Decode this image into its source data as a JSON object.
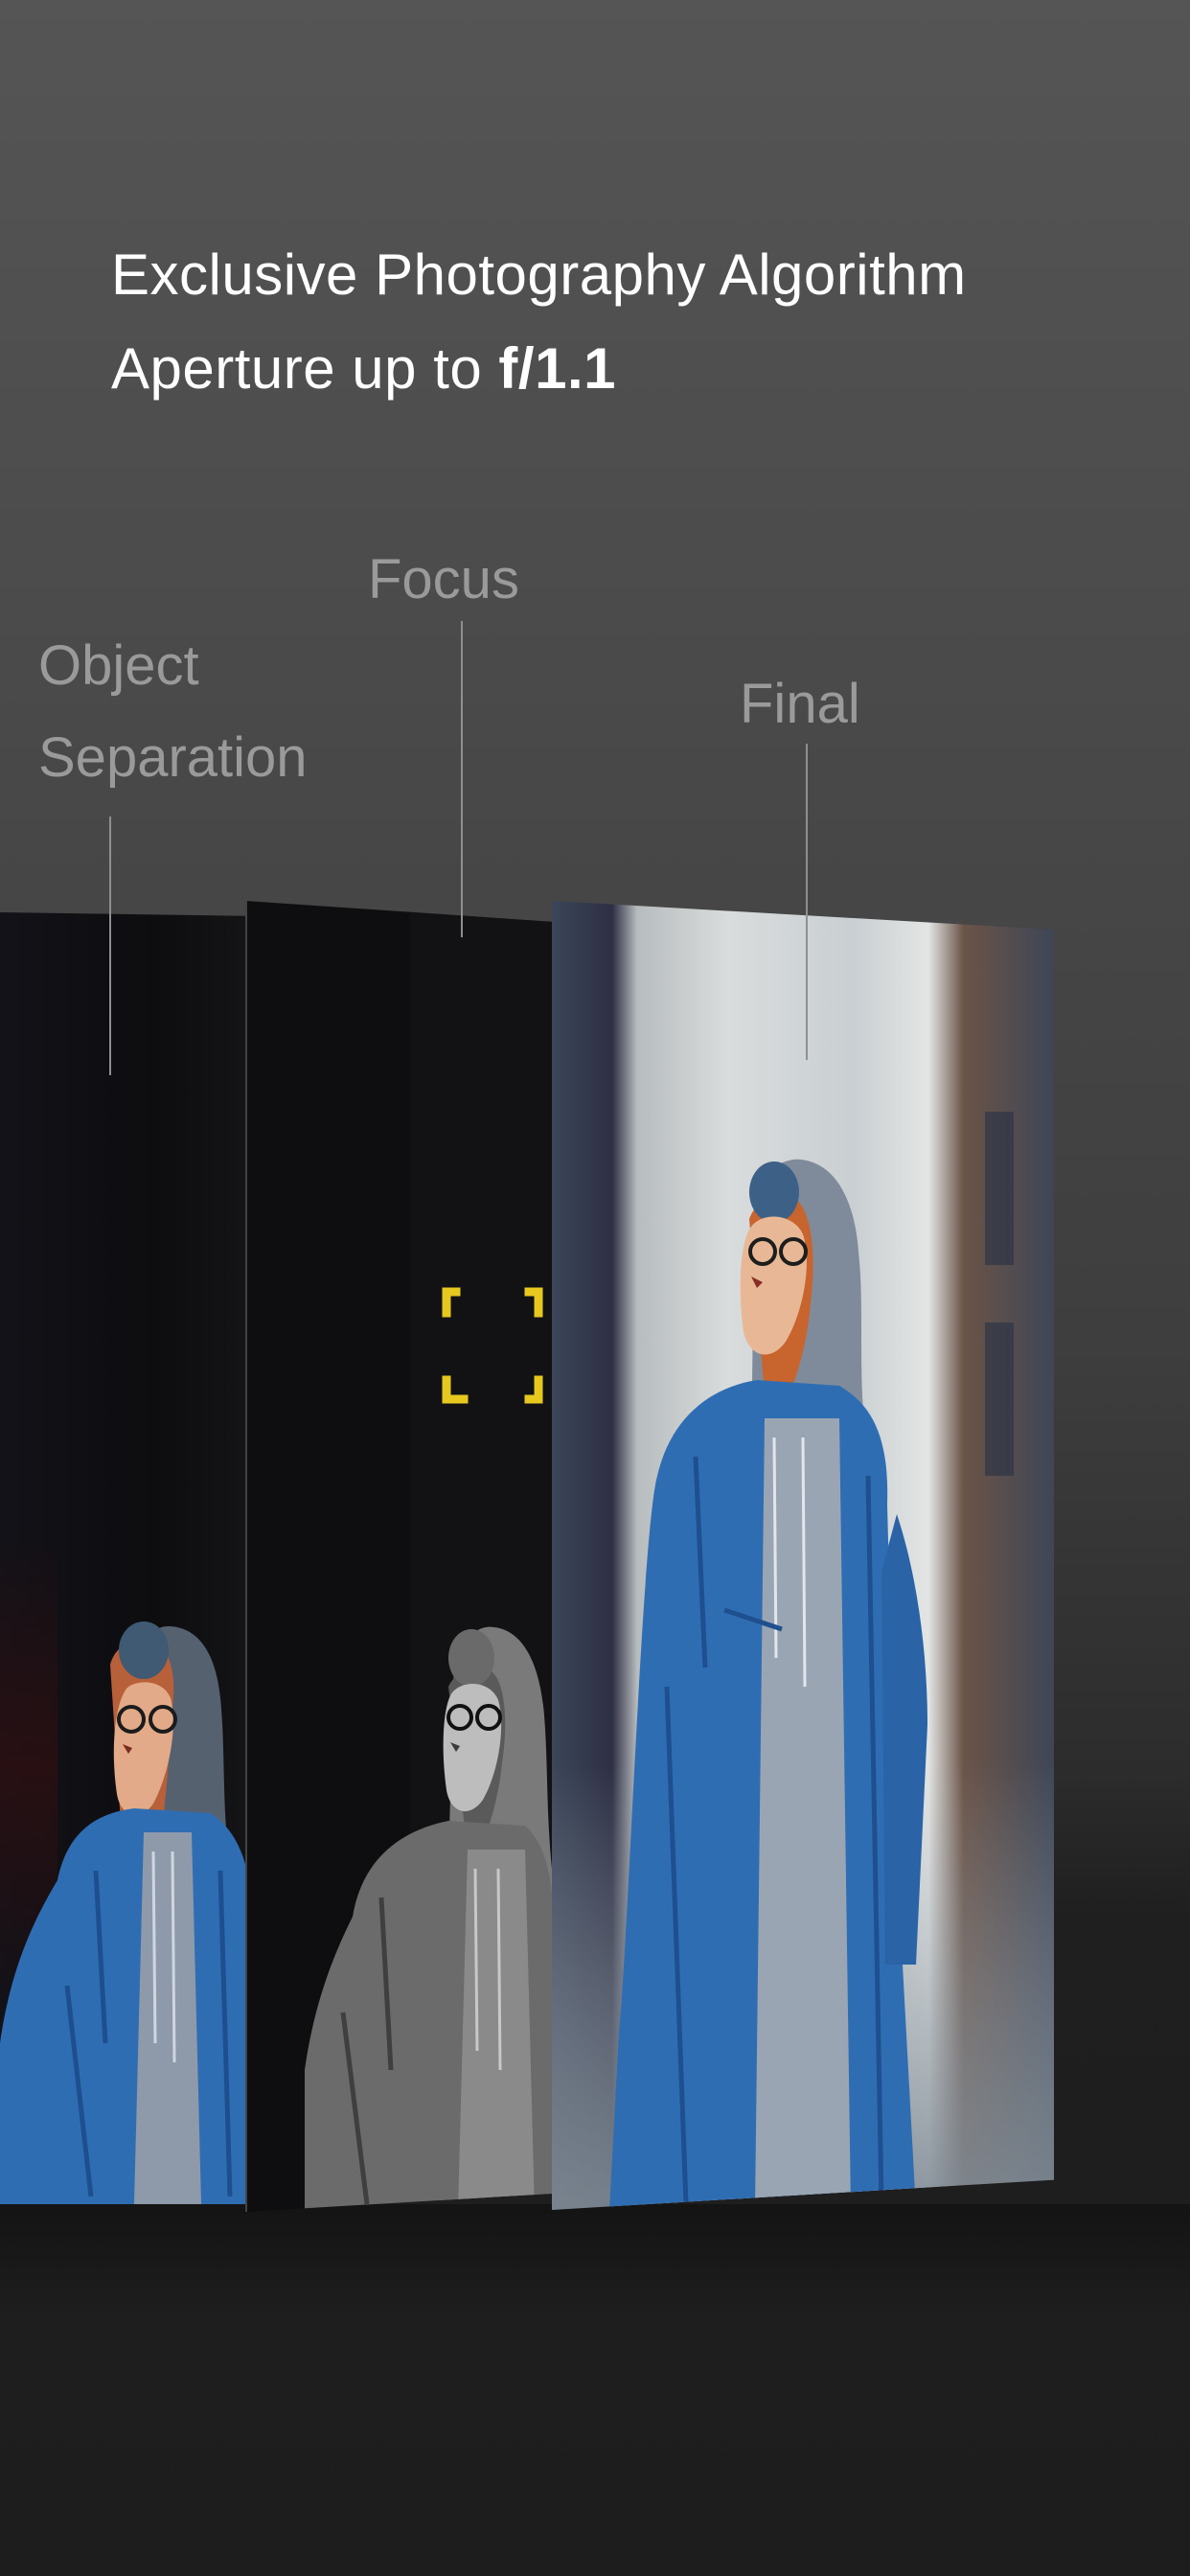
{
  "headline": {
    "line1": "Exclusive Photography Algorithm",
    "line2_prefix": "Aperture up to ",
    "line2_emphasis": "f/1.1"
  },
  "labels": {
    "object_line1": "Object",
    "object_line2": "Separation",
    "focus": "Focus",
    "final": "Final"
  },
  "colors": {
    "background_top": "#555555",
    "background_bottom": "#1d1d1d",
    "label_gray": "#9a9a9a",
    "focus_bracket_yellow": "#e6c81e",
    "jacket_blue": "#2f6db3",
    "hair_orange": "#c8642e"
  },
  "icons": {
    "focus_marker": "focus-bracket-icon"
  }
}
